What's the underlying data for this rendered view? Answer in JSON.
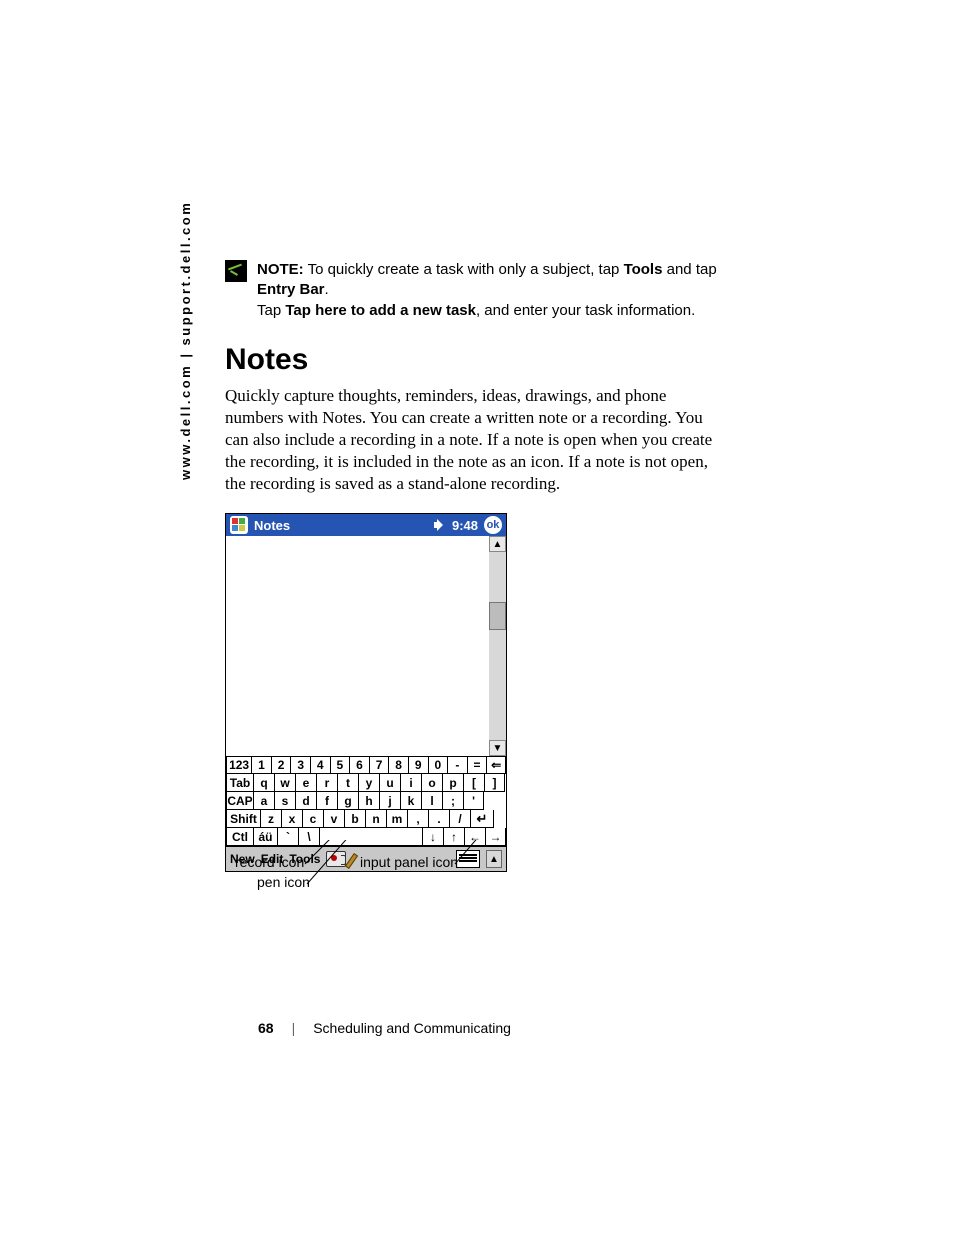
{
  "side_url": "www.dell.com | support.dell.com",
  "note_block": {
    "prefix": "NOTE:",
    "line1_a": " To quickly create a task with only a subject, tap ",
    "line1_b": "Tools",
    "line1_c": " and tap ",
    "line1_d": "Entry Bar",
    "line1_e": ".",
    "line2_a": "Tap ",
    "line2_b": "Tap here to add a new task",
    "line2_c": ", and enter your task information."
  },
  "section_heading": "Notes",
  "body_text": "Quickly capture thoughts, reminders, ideas, drawings, and phone numbers with Notes. You can create a written note or a recording. You can also include a recording in a note. If a note is open when you create the recording, it is included in the note as an icon. If a note is not open, the recording is saved as a stand-alone recording.",
  "device": {
    "title": "Notes",
    "time": "9:48",
    "ok": "ok",
    "bottom": {
      "new": "New",
      "edit": "Edit",
      "tools": "Tools"
    }
  },
  "keyboard": {
    "row1": [
      "123",
      "1",
      "2",
      "3",
      "4",
      "5",
      "6",
      "7",
      "8",
      "9",
      "0",
      "-",
      "=",
      "bksp"
    ],
    "row2": [
      "Tab",
      "q",
      "w",
      "e",
      "r",
      "t",
      "y",
      "u",
      "i",
      "o",
      "p",
      "[",
      "]"
    ],
    "row3": [
      "CAP",
      "a",
      "s",
      "d",
      "f",
      "g",
      "h",
      "j",
      "k",
      "l",
      ";",
      "'"
    ],
    "row4": [
      "Shift",
      "z",
      "x",
      "c",
      "v",
      "b",
      "n",
      "m",
      ",",
      ".",
      "/",
      "enter"
    ],
    "row5": [
      "Ctl",
      "áü",
      "`",
      "\\",
      "space",
      "down",
      "up",
      "left",
      "right"
    ]
  },
  "callouts": {
    "record": "record icon",
    "pen": "pen icon",
    "input_panel": "input panel icon"
  },
  "footer": {
    "page": "68",
    "chapter": "Scheduling and Communicating"
  }
}
